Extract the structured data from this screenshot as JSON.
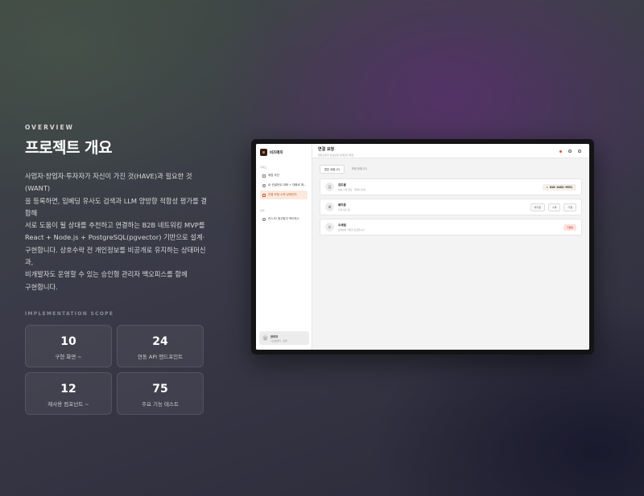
{
  "hero": {
    "eyebrow": "OVERVIEW",
    "title": "프로젝트 개요",
    "description_lines": [
      "사업자·창업자·투자자가 자신이 가진 것(HAVE)과 필요한 것(WANT)",
      "을 등록하면, 임베딩 유사도 검색과 LLM 양방향 적합성 평가를 결합해",
      "서로 도움이 될 상대를 추천하고 연결하는 B2B 네트워킹 MVP를",
      "React + Node.js + PostgreSQL(pgvector) 기반으로 설계·",
      "구현합니다. 상호수락 전 개인정보를 비공개로 유지하는 상태머신과,",
      "비개발자도 운영할 수 있는 승인형 관리자 백오피스를 함께",
      "구현합니다."
    ]
  },
  "scope": {
    "label": "IMPLEMENTATION SCOPE",
    "stats": [
      {
        "value": "10",
        "label": "구현 화면 ~"
      },
      {
        "value": "24",
        "label": "연동 API 엔드포인트"
      },
      {
        "value": "12",
        "label": "재사용 컴포넌트 ~"
      },
      {
        "value": "75",
        "label": "주요 기능 테스트"
      }
    ]
  },
  "app": {
    "brand": "비즈매치",
    "sidebar": {
      "section1": "서비스",
      "items1": [
        {
          "label": "매칭 추천",
          "icon": "link-icon",
          "active": false
        },
        {
          "label": "AI 컨설턴트 대화 + 대화로 매...",
          "icon": "chat-icon",
          "active": false
        },
        {
          "label": "연결 요청 수락 상태관리",
          "icon": "inbox-icon",
          "active": true
        }
      ],
      "section2": "관리",
      "items2": [
        {
          "label": "리스크/ 광고탐지 백오피스",
          "icon": "shield-icon",
          "active": false
        }
      ],
      "user": {
        "initial": "관",
        "name": "관리자",
        "role": "시스템관리 · 운영"
      }
    },
    "topbar": {
      "title": "연결 요청",
      "subtitle": "받은요청과 보낸요청 상태관리 화면"
    },
    "tabs": [
      "받은 요청 (3)",
      "보낸 요청 (2)"
    ],
    "requests": [
      {
        "initial": "김",
        "name": "김도윤",
        "sub": "상호 수락 완료 · 연락처 공개",
        "phone": "010-4482-9931"
      },
      {
        "initial": "배",
        "name": "배지훈",
        "sub": "수락 대기 중",
        "actions": [
          "대기중",
          "수락",
          "거절"
        ]
      },
      {
        "initial": "오",
        "name": "오세림",
        "sub": "상대방이 거절한 요청입니다",
        "status": "거절됨"
      }
    ]
  },
  "colors": {
    "accent": "#e56a2b",
    "reject": "#c0392b"
  }
}
